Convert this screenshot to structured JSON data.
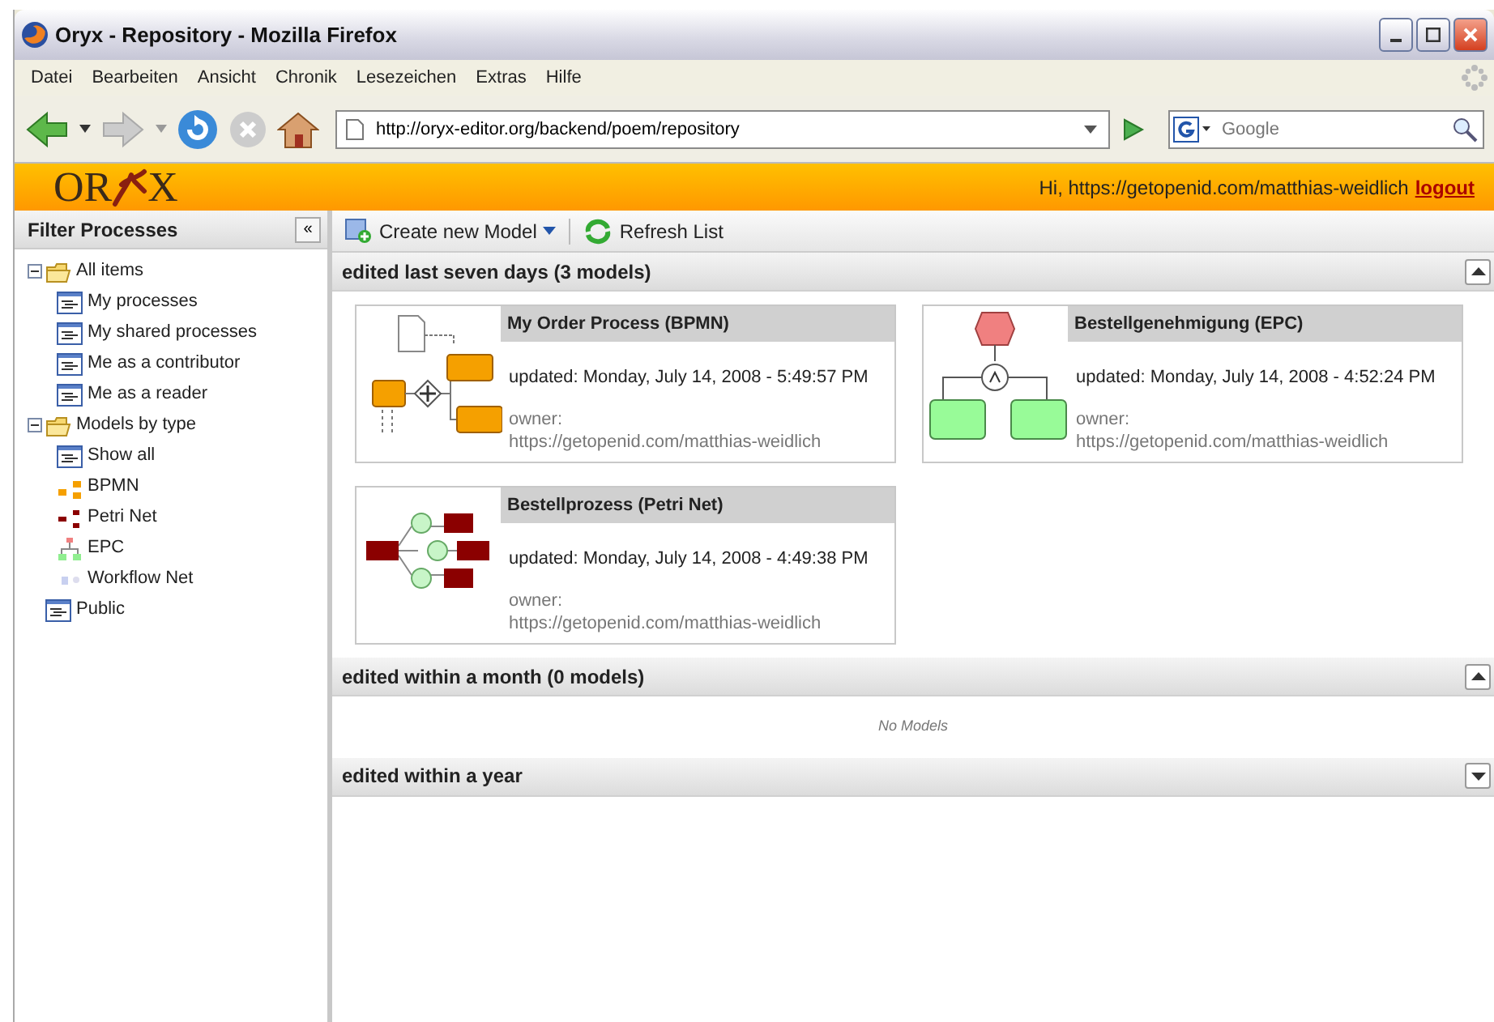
{
  "window": {
    "title": "Oryx - Repository - Mozilla Firefox"
  },
  "menu": [
    "Datei",
    "Bearbeiten",
    "Ansicht",
    "Chronik",
    "Lesezeichen",
    "Extras",
    "Hilfe"
  ],
  "navbar": {
    "url": "http://oryx-editor.org/backend/poem/repository",
    "search_placeholder": "Google"
  },
  "header": {
    "logo_left": "OR",
    "logo_right": "X",
    "greeting": "Hi, https://getopenid.com/matthias-weidlich",
    "logout": "logout"
  },
  "sidebar": {
    "title": "Filter Processes",
    "collapse": "«",
    "tree": [
      {
        "label": "All items",
        "kind": "folder",
        "expanded": true,
        "children": [
          {
            "label": "My processes",
            "kind": "list"
          },
          {
            "label": "My shared processes",
            "kind": "list"
          },
          {
            "label": "Me as a contributor",
            "kind": "list"
          },
          {
            "label": "Me as a reader",
            "kind": "list"
          }
        ]
      },
      {
        "label": "Models by type",
        "kind": "folder",
        "expanded": true,
        "children": [
          {
            "label": "Show all",
            "kind": "list"
          },
          {
            "label": "BPMN",
            "kind": "bpmn"
          },
          {
            "label": "Petri Net",
            "kind": "petri"
          },
          {
            "label": "EPC",
            "kind": "epc"
          },
          {
            "label": "Workflow Net",
            "kind": "workflow"
          }
        ]
      },
      {
        "label": "Public",
        "kind": "list"
      }
    ]
  },
  "toolbar": [
    {
      "label": "Create new Model",
      "kind": "create",
      "dropdown": true
    },
    {
      "label": "Refresh List",
      "kind": "refresh",
      "dropdown": false
    }
  ],
  "sections": [
    {
      "title": "edited last seven days (3 models)",
      "expanded": true,
      "models": [
        {
          "title": "My Order Process (BPMN)",
          "kind": "bpmn",
          "updated": "updated: Monday, July 14, 2008 - 5:49:57 PM",
          "owner_label": "owner:",
          "owner": "https://getopenid.com/matthias-weidlich"
        },
        {
          "title": "Bestellgenehmigung (EPC)",
          "kind": "epc",
          "updated": "updated: Monday, July 14, 2008 - 4:52:24 PM",
          "owner_label": "owner:",
          "owner": "https://getopenid.com/matthias-weidlich"
        },
        {
          "title": "Bestellprozess (Petri Net)",
          "kind": "petri",
          "updated": "updated: Monday, July 14, 2008 - 4:49:38 PM",
          "owner_label": "owner:",
          "owner": "https://getopenid.com/matthias-weidlich"
        }
      ]
    },
    {
      "title": "edited within a month (0 models)",
      "expanded": true,
      "empty_text": "No Models"
    },
    {
      "title": "edited within a year",
      "expanded": false
    }
  ]
}
